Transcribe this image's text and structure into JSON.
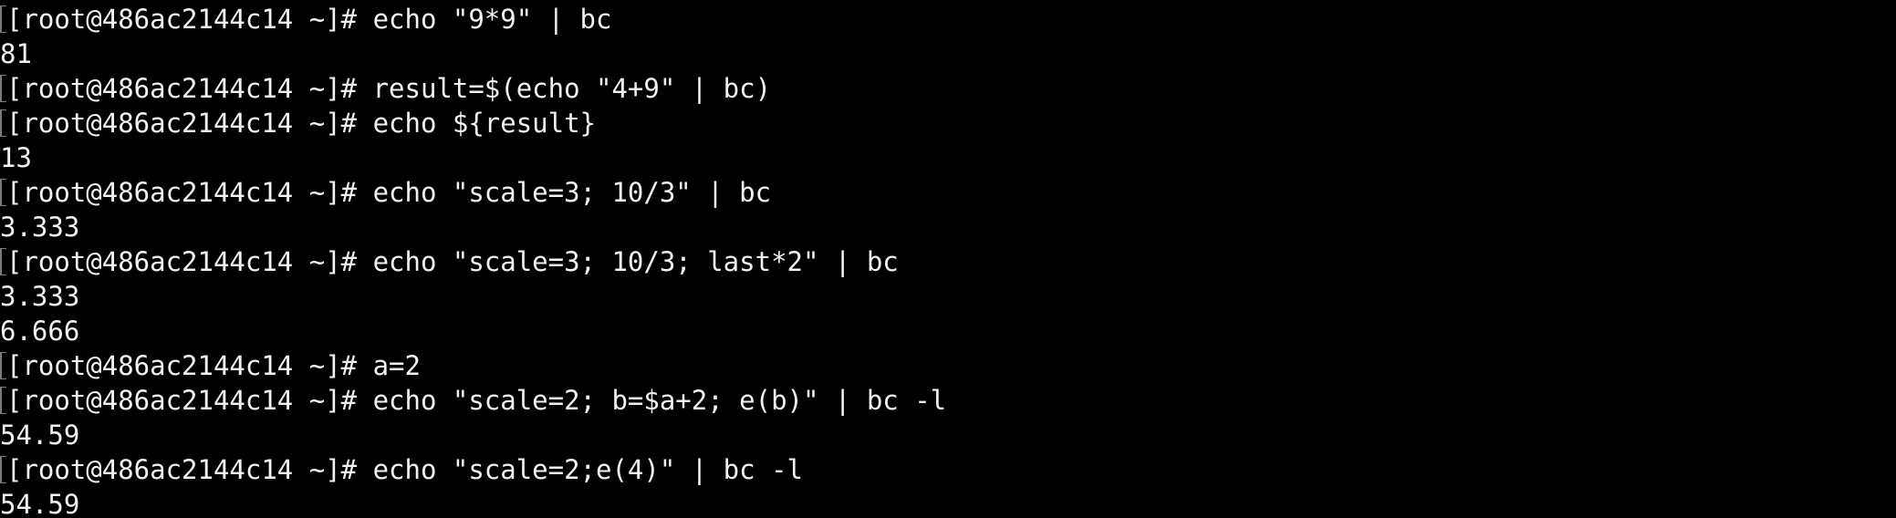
{
  "terminal": {
    "lines": [
      {
        "type": "input",
        "prompt": "[root@486ac2144c14 ~]# ",
        "command": "echo \"9*9\" | bc"
      },
      {
        "type": "output",
        "text": "81"
      },
      {
        "type": "input",
        "prompt": "[root@486ac2144c14 ~]# ",
        "command": "result=$(echo \"4+9\" | bc)"
      },
      {
        "type": "input",
        "prompt": "[root@486ac2144c14 ~]# ",
        "command": "echo ${result}"
      },
      {
        "type": "output",
        "text": "13"
      },
      {
        "type": "input",
        "prompt": "[root@486ac2144c14 ~]# ",
        "command": "echo \"scale=3; 10/3\" | bc"
      },
      {
        "type": "output",
        "text": "3.333"
      },
      {
        "type": "input",
        "prompt": "[root@486ac2144c14 ~]# ",
        "command": "echo \"scale=3; 10/3; last*2\" | bc"
      },
      {
        "type": "output",
        "text": "3.333"
      },
      {
        "type": "output",
        "text": "6.666"
      },
      {
        "type": "input",
        "prompt": "[root@486ac2144c14 ~]# ",
        "command": "a=2"
      },
      {
        "type": "input",
        "prompt": "[root@486ac2144c14 ~]# ",
        "command": "echo \"scale=2; b=$a+2; e(b)\" | bc -l"
      },
      {
        "type": "output",
        "text": "54.59"
      },
      {
        "type": "input",
        "prompt": "[root@486ac2144c14 ~]# ",
        "command": "echo \"scale=2;e(4)\" | bc -l"
      },
      {
        "type": "output",
        "text": "54.59"
      }
    ]
  }
}
